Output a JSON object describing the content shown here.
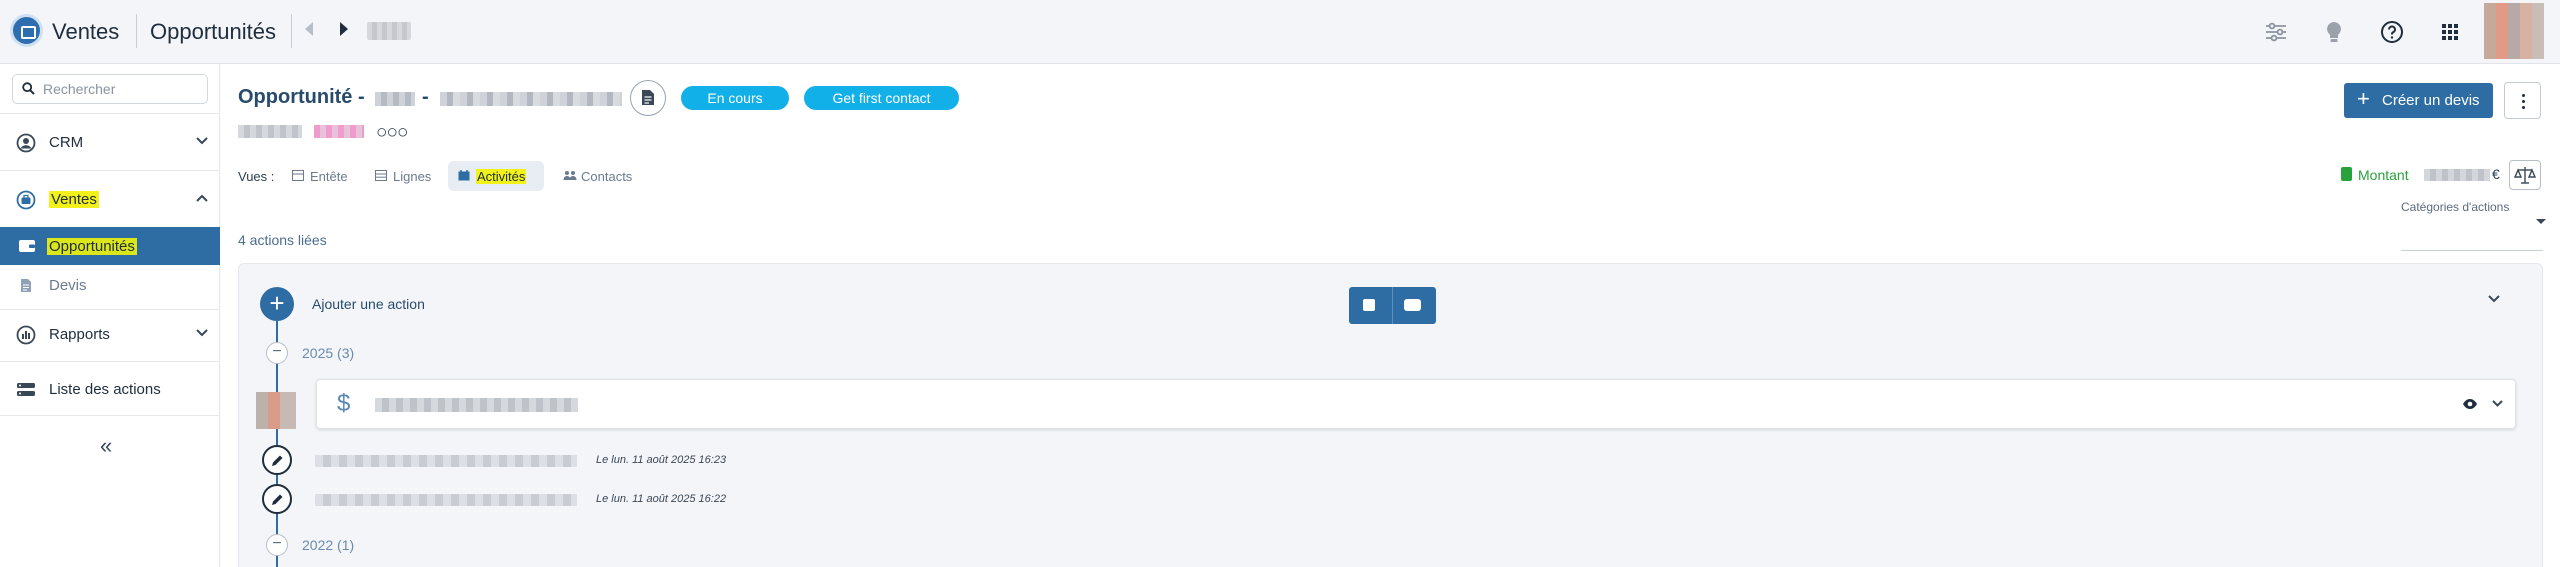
{
  "topbar": {
    "app_name": "Ventes",
    "section_name": "Opportunités",
    "icons": [
      "settings-sliders-icon",
      "lightbulb-icon",
      "help-icon",
      "apps-grid-icon"
    ]
  },
  "sidebar": {
    "search_placeholder": "Rechercher",
    "items": [
      {
        "label": "CRM",
        "icon": "user-circle-icon"
      },
      {
        "label": "Ventes",
        "icon": "briefcase-circle-icon"
      },
      {
        "label": "Opportunités",
        "icon": "wallet-icon"
      },
      {
        "label": "Devis",
        "icon": "document-icon"
      },
      {
        "label": "Rapports",
        "icon": "chart-icon"
      },
      {
        "label": "Liste des actions",
        "icon": "list-icon"
      }
    ],
    "collapse_label": "«"
  },
  "record": {
    "title_prefix": "Opportunité -",
    "title_sep": "-",
    "status_badge": "En cours",
    "stage_badge": "Get first contact",
    "rating": "○○○"
  },
  "views": {
    "label": "Vues :",
    "tabs": [
      {
        "label": "Entête",
        "active": false
      },
      {
        "label": "Lignes",
        "active": false
      },
      {
        "label": "Activités",
        "active": true
      },
      {
        "label": "Contacts",
        "active": false
      }
    ]
  },
  "actions": {
    "create_quote": "Créer un devis",
    "montant_label": "Montant",
    "currency": "€",
    "categories_label": "Catégories d'actions"
  },
  "activity": {
    "count_label": "4 actions liées",
    "add_label": "Ajouter une action",
    "groups": [
      {
        "year_label": "2025 (3)"
      },
      {
        "year_label": "2022 (1)"
      }
    ],
    "history": [
      {
        "date": "Le lun. 11 août 2025 16:23"
      },
      {
        "date": "Le lun. 11 août 2025 16:22"
      }
    ]
  },
  "colors": {
    "primary": "#2e6da4",
    "badge": "#12b0e8",
    "highlight": "#f2f21a",
    "montant": "#2aa23c"
  }
}
